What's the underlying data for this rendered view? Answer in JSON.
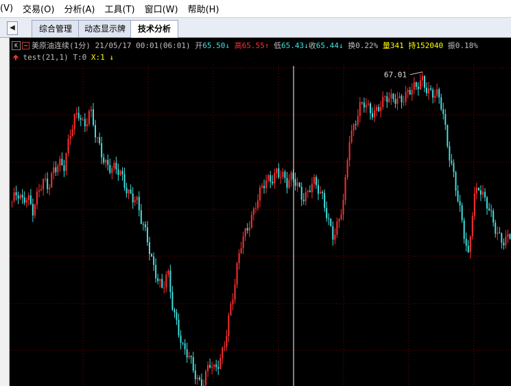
{
  "menu": [
    "(V)",
    "交易(O)",
    "分析(A)",
    "工具(T)",
    "窗口(W)",
    "帮助(H)"
  ],
  "tabs": [
    {
      "label": "综合管理",
      "active": false
    },
    {
      "label": "动态显示牌",
      "active": false
    },
    {
      "label": "技术分析",
      "active": true
    }
  ],
  "tab_scroll_glyph": "◀",
  "info": {
    "k_badge": "K",
    "symbol": "美原油连续(1分)",
    "datetime": "21/05/17 00:01(06:01)",
    "open_label": "开",
    "open_value": "65.50",
    "high_label": "高",
    "high_value": "65.55",
    "low_label": "低",
    "low_value": "65.43",
    "close_label": "收",
    "close_value": "65.44",
    "change_label": "换",
    "change_value": "0.22%",
    "volume_label": "量",
    "volume_value": "341",
    "oi_label": "持",
    "oi_value": "152040",
    "amp_label": "振",
    "amp_value": "0.18%",
    "arrow_down": "↓",
    "arrow_up": "↑"
  },
  "indicator": {
    "name": "test(21,1)",
    "t_label": "T:0",
    "x_label": "X:1"
  },
  "chart_data": {
    "type": "candlestick",
    "high_marker_label": "67.01",
    "colors": {
      "up": "#ff3030",
      "down": "#40e0e0",
      "grid": "#8b0000",
      "cursor": "#ffffff",
      "background": "#000000"
    },
    "close_series": [
      65.5,
      65.55,
      65.47,
      65.6,
      65.42,
      65.58,
      65.7,
      65.65,
      65.92,
      66.0,
      65.88,
      66.2,
      66.52,
      66.62,
      66.4,
      66.58,
      66.3,
      66.15,
      66.0,
      65.9,
      65.85,
      65.8,
      65.68,
      65.6,
      65.5,
      65.2,
      65.05,
      64.8,
      64.6,
      64.4,
      64.6,
      64.2,
      64.0,
      63.72,
      63.6,
      63.4,
      63.3,
      63.35,
      63.55,
      63.4,
      63.5,
      63.8,
      64.2,
      64.5,
      64.9,
      65.1,
      65.3,
      65.5,
      65.62,
      65.7,
      65.75,
      65.9,
      65.85,
      65.68,
      65.75,
      65.72,
      65.58,
      65.6,
      65.7,
      65.62,
      65.55,
      65.3,
      65.05,
      65.2,
      65.52,
      66.3,
      66.45,
      66.62,
      66.65,
      66.58,
      66.62,
      66.7,
      66.72,
      66.7,
      66.75,
      66.78,
      66.8,
      66.82,
      66.85,
      67.01,
      66.9,
      66.8,
      66.75,
      66.6,
      66.2,
      65.9,
      65.5,
      65.1,
      64.8,
      65.6,
      65.7,
      65.5,
      65.35,
      65.2,
      65.1,
      65.02,
      65.05
    ]
  }
}
